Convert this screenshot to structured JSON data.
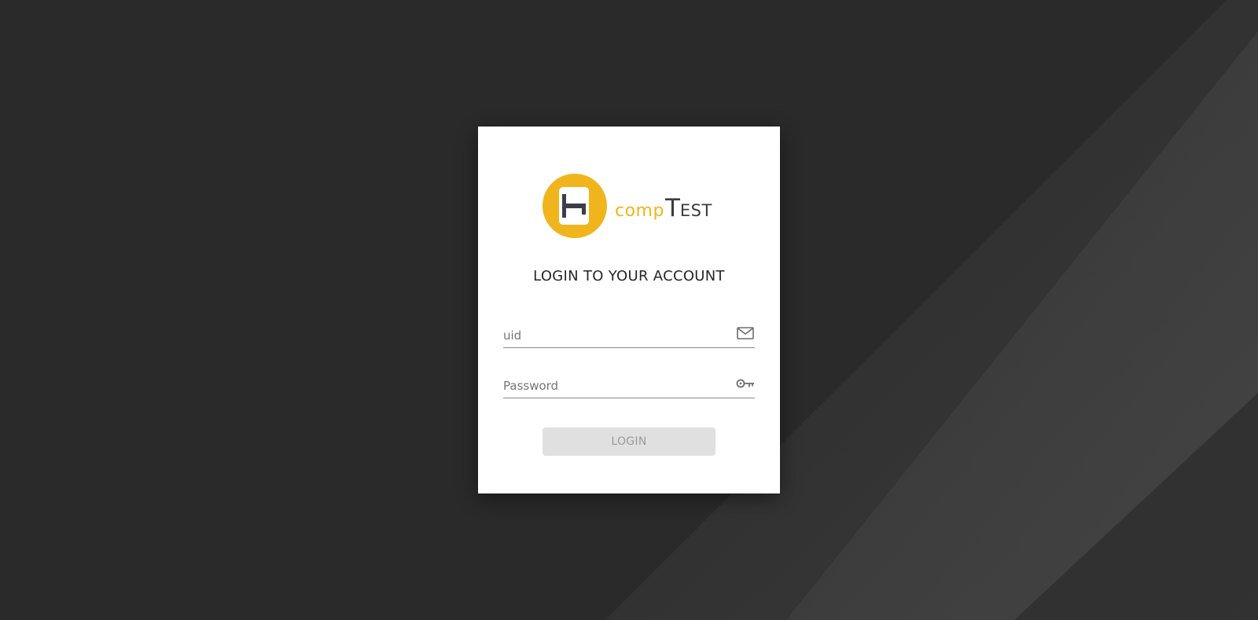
{
  "brand": {
    "name_part1": "comp",
    "name_part2": "T",
    "name_part3": "est",
    "accent_color": "#f0b51c",
    "text_color": "#3c3c3c"
  },
  "login": {
    "title": "LOGIN TO YOUR ACCOUNT",
    "uid_placeholder": "uid",
    "uid_value": "",
    "uid_icon": "mail-icon",
    "password_placeholder": "Password",
    "password_value": "",
    "password_icon": "key-icon",
    "button_label": "LOGIN",
    "button_disabled": true
  },
  "colors": {
    "background": "#2a2a2a",
    "card": "#ffffff",
    "button_disabled_bg": "#e0e0e0",
    "button_disabled_text": "#9a9a9a"
  }
}
